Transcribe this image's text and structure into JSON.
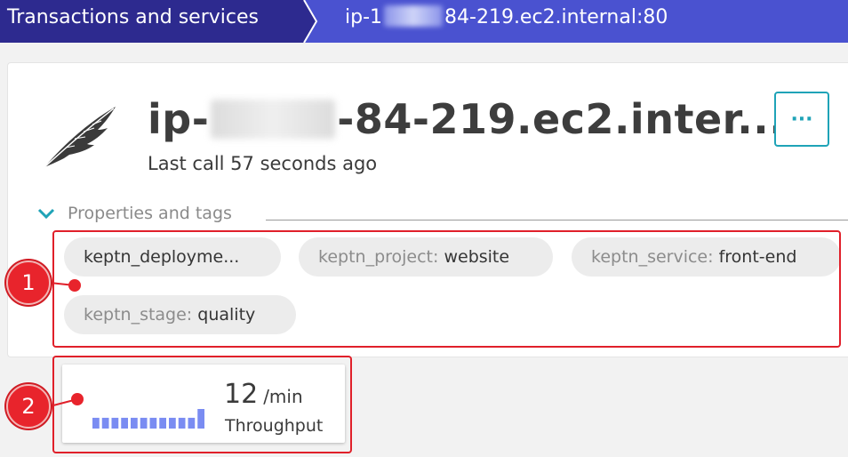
{
  "breadcrumb": {
    "items": [
      {
        "label": "Transactions and services"
      },
      {
        "label_prefix": "ip-1",
        "label_suffix": "84-219.ec2.internal:80"
      }
    ]
  },
  "service": {
    "title_prefix": "ip-",
    "title_suffix": "-84-219.ec2.inter...",
    "last_call": "Last call 57 seconds ago",
    "menu_label": "···",
    "icon": "feather-icon"
  },
  "properties": {
    "toggle_label": "Properties and tags",
    "tags": [
      {
        "key": "keptn_deployme...",
        "value": ""
      },
      {
        "key": "keptn_project:",
        "value": "website"
      },
      {
        "key": "keptn_service:",
        "value": "front-end"
      },
      {
        "key": "keptn_stage:",
        "value": "quality"
      }
    ]
  },
  "throughput": {
    "value": "12",
    "unit": "/min",
    "label": "Throughput",
    "sparkline": [
      0.55,
      0.55,
      0.55,
      0.55,
      0.55,
      0.55,
      0.55,
      0.55,
      0.55,
      0.55,
      0.55,
      1.0
    ],
    "bar_color": "#7a8cf2"
  },
  "annotations": [
    {
      "number": "1"
    },
    {
      "number": "2"
    }
  ],
  "colors": {
    "breadcrumb_dark": "#2d2a8f",
    "breadcrumb_light": "#4a52d0",
    "accent_teal": "#1fa3b7",
    "annotation_red": "#e8242c"
  }
}
